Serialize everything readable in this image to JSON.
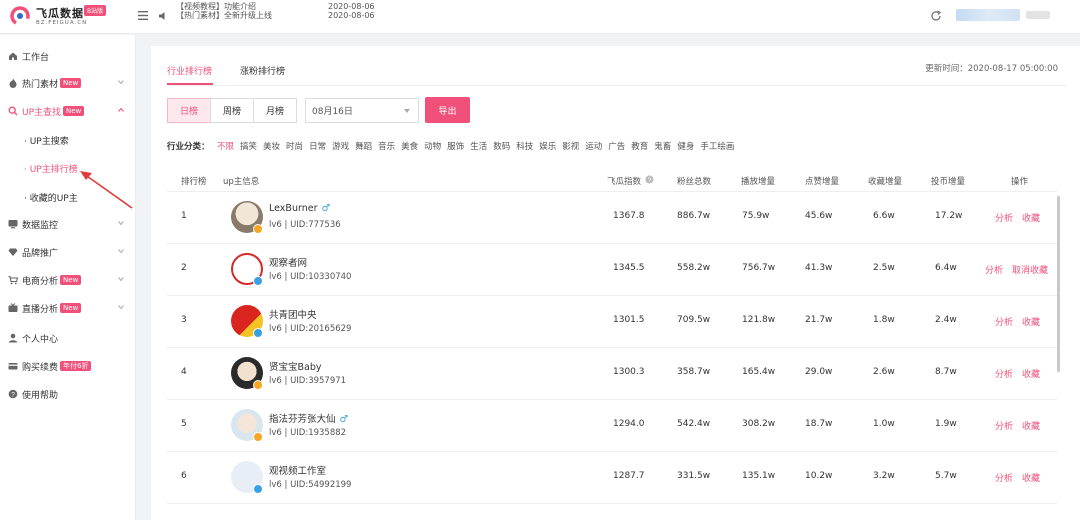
{
  "header": {
    "logo_title": "飞瓜数据",
    "logo_badge": "B站版",
    "logo_sub": "BZ.FEIGUA.CN",
    "notice_lines": [
      "【视频教程】功能介绍",
      "【热门素材】全新升级上线"
    ],
    "notice_date_lines": [
      "2020-08-06",
      "2020-08-06"
    ]
  },
  "sidebar": {
    "items": [
      {
        "label": "工作台"
      },
      {
        "label": "热门素材",
        "badge": "New"
      },
      {
        "label": "UP主查找",
        "badge": "New"
      },
      {
        "label": "数据监控"
      },
      {
        "label": "品牌推广"
      },
      {
        "label": "电商分析",
        "badge": "New"
      },
      {
        "label": "直播分析",
        "badge": "New"
      },
      {
        "label": "个人中心"
      },
      {
        "label": "购买续费",
        "badge": "年付6折"
      },
      {
        "label": "使用帮助"
      }
    ],
    "sub_items": [
      {
        "label": "· UP主搜索"
      },
      {
        "label": "· UP主排行榜"
      },
      {
        "label": "· 收藏的UP主"
      }
    ]
  },
  "main": {
    "tabs": [
      {
        "label": "行业排行榜"
      },
      {
        "label": "涨粉排行榜"
      }
    ],
    "update_time": "更新时间：2020-08-17 05:00:00",
    "periods": [
      {
        "label": "日榜"
      },
      {
        "label": "周榜"
      },
      {
        "label": "月榜"
      }
    ],
    "date_value": "08月16日",
    "export_label": "导出",
    "category_label": "行业分类：",
    "categories": [
      "不限",
      "搞笑",
      "美妆",
      "时尚",
      "日常",
      "游戏",
      "舞蹈",
      "音乐",
      "美食",
      "动物",
      "服饰",
      "生活",
      "数码",
      "科技",
      "娱乐",
      "影视",
      "运动",
      "广告",
      "教育",
      "鬼畜",
      "健身",
      "手工绘画"
    ],
    "columns": [
      "排行榜",
      "up主信息",
      "飞瓜指数",
      "粉丝总数",
      "播放增量",
      "点赞增量",
      "收藏增量",
      "投币增量",
      "操作"
    ],
    "rows": [
      {
        "rank": "1",
        "name": "LexBurner",
        "male": "♂",
        "uid": "lv6 | UID:777536",
        "index": "1367.8",
        "fans": "886.7w",
        "play": "75.9w",
        "like": "45.6w",
        "fav": "6.6w",
        "coin": "17.2w",
        "op1": "分析",
        "op2": "收藏"
      },
      {
        "rank": "2",
        "name": "观察者网",
        "male": "",
        "uid": "lv6 | UID:10330740",
        "index": "1345.5",
        "fans": "558.2w",
        "play": "756.7w",
        "like": "41.3w",
        "fav": "2.5w",
        "coin": "6.4w",
        "op1": "分析",
        "op2": "取消收藏"
      },
      {
        "rank": "3",
        "name": "共青团中央",
        "male": "",
        "uid": "lv6 | UID:20165629",
        "index": "1301.5",
        "fans": "709.5w",
        "play": "121.8w",
        "like": "21.7w",
        "fav": "1.8w",
        "coin": "2.4w",
        "op1": "分析",
        "op2": "收藏"
      },
      {
        "rank": "4",
        "name": "贤宝宝Baby",
        "male": "",
        "uid": "lv6 | UID:3957971",
        "index": "1300.3",
        "fans": "358.7w",
        "play": "165.4w",
        "like": "29.0w",
        "fav": "2.6w",
        "coin": "8.7w",
        "op1": "分析",
        "op2": "收藏"
      },
      {
        "rank": "5",
        "name": "指法芬芳张大仙",
        "male": "♂",
        "uid": "lv6 | UID:1935882",
        "index": "1294.0",
        "fans": "542.4w",
        "play": "308.2w",
        "like": "18.7w",
        "fav": "1.0w",
        "coin": "1.9w",
        "op1": "分析",
        "op2": "收藏"
      },
      {
        "rank": "6",
        "name": "观视频工作室",
        "male": "",
        "uid": "lv6 | UID:54992199",
        "index": "1287.7",
        "fans": "331.5w",
        "play": "135.1w",
        "like": "10.2w",
        "fav": "3.2w",
        "coin": "5.7w",
        "op1": "分析",
        "op2": "收藏"
      }
    ]
  },
  "colors": {
    "accent": "#f0507a",
    "verify": "#f5a623",
    "verify_blue": "#3aa0e6"
  }
}
